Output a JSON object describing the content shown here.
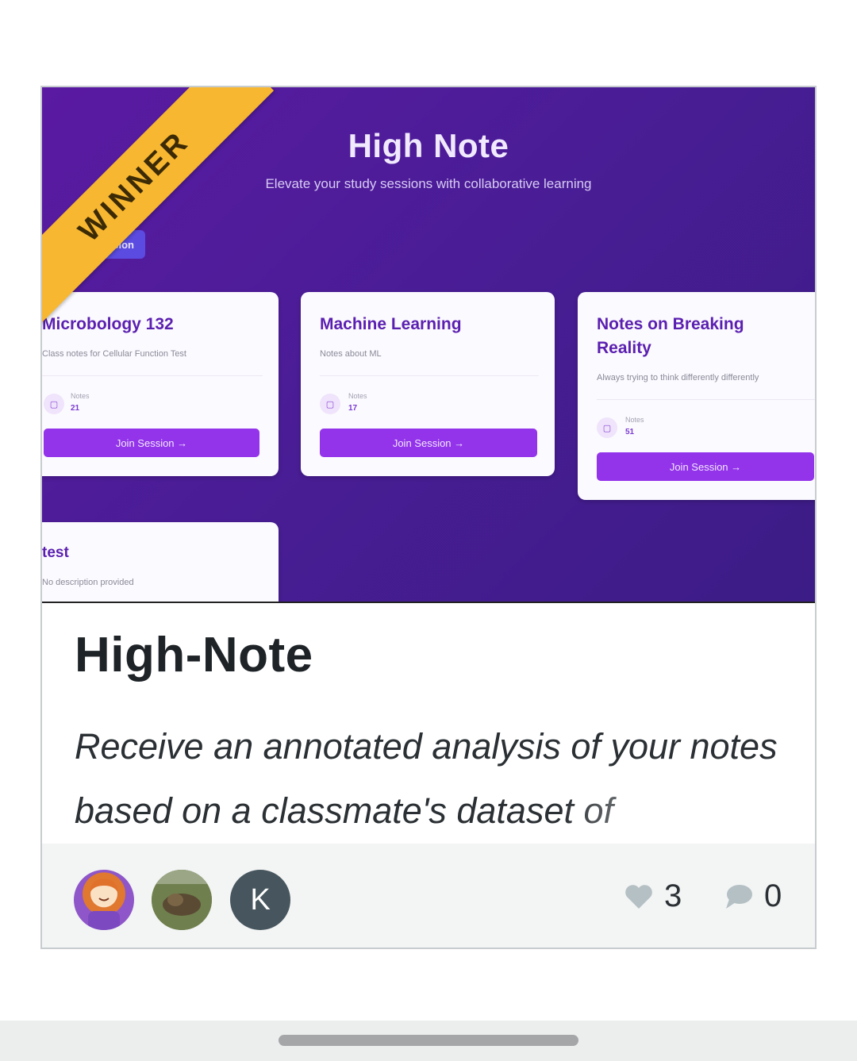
{
  "thumbnail": {
    "app_title": "High Note",
    "subtitle": "Elevate your study sessions with collaborative learning",
    "create_button": "Session",
    "sessions": [
      {
        "title": "Microbology 132",
        "description": "Class notes for Cellular Function Test",
        "notes_label": "Notes",
        "notes_count": "21",
        "join_label": "Join Session →"
      },
      {
        "title": "Machine Learning",
        "description": "Notes about ML",
        "notes_label": "Notes",
        "notes_count": "17",
        "join_label": "Join Session →"
      },
      {
        "title": "Notes on Breaking Reality",
        "description": "Always trying to think differently differently",
        "notes_label": "Notes",
        "notes_count": "51",
        "join_label": "Join Session →"
      },
      {
        "title": "test",
        "description": "No description provided"
      }
    ]
  },
  "badge": {
    "label": "WINNER",
    "color": "#f7b731"
  },
  "project": {
    "title": "High-Note",
    "description": "Receive an annotated analysis of your notes based on a classmate's dataset of"
  },
  "team": {
    "avatars": [
      {
        "type": "image",
        "name": "avatar-1"
      },
      {
        "type": "image",
        "name": "avatar-2"
      },
      {
        "type": "initial",
        "initial": "K"
      }
    ]
  },
  "stats": {
    "likes": "3",
    "comments": "0"
  },
  "colors": {
    "accent_purple": "#9333ea",
    "header_bg": "#4a1d96"
  }
}
